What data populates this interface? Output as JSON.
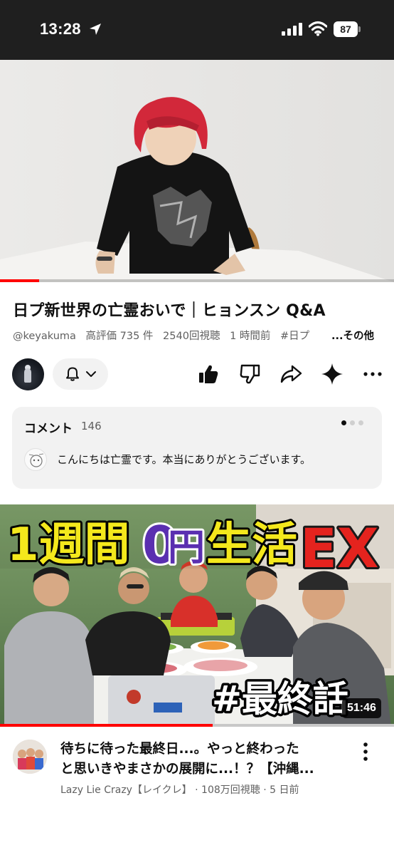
{
  "status_bar": {
    "time": "13:28",
    "battery": "87"
  },
  "player": {
    "progress": 0.1
  },
  "video": {
    "title": "日プ新世界の亡霊おいで｜ヒョンスン Q&A",
    "channel_handle": "@keyakuma",
    "likes": "高評価 735 件",
    "views": "2540回視聴",
    "posted": "1 時間前",
    "hashtag": "#日プ",
    "more": "...その他"
  },
  "actions": {
    "icons": [
      "like-icon",
      "dislike-icon",
      "share-icon",
      "sparkle-icon",
      "more-icon"
    ]
  },
  "comments": {
    "title": "コメント",
    "count": "146",
    "top_comment": "こんにちは亡霊です。本当にありがとうございます。",
    "pager": {
      "total": 3,
      "active": 0
    }
  },
  "recommended": {
    "thumb_headline_1": "1週間",
    "thumb_headline_2": "0",
    "thumb_headline_3": "円",
    "thumb_headline_4": "生活",
    "thumb_headline_5": "EX",
    "thumb_tag": "#最終話",
    "duration": "51:46",
    "watched": 0.54,
    "title_line1": "待ちに待った最終日...。やっと終わった",
    "title_line2": "と思いきやまさかの展開に...！？【沖縄...",
    "channel": "Lazy Lie Crazy【レイクレ】",
    "views": "108万回視聴",
    "posted": "5 日前",
    "colors": {
      "accent_red": "#ff0000",
      "headline_yellow": "#f4e81c",
      "headline_purple": "#5a2fb0"
    }
  }
}
